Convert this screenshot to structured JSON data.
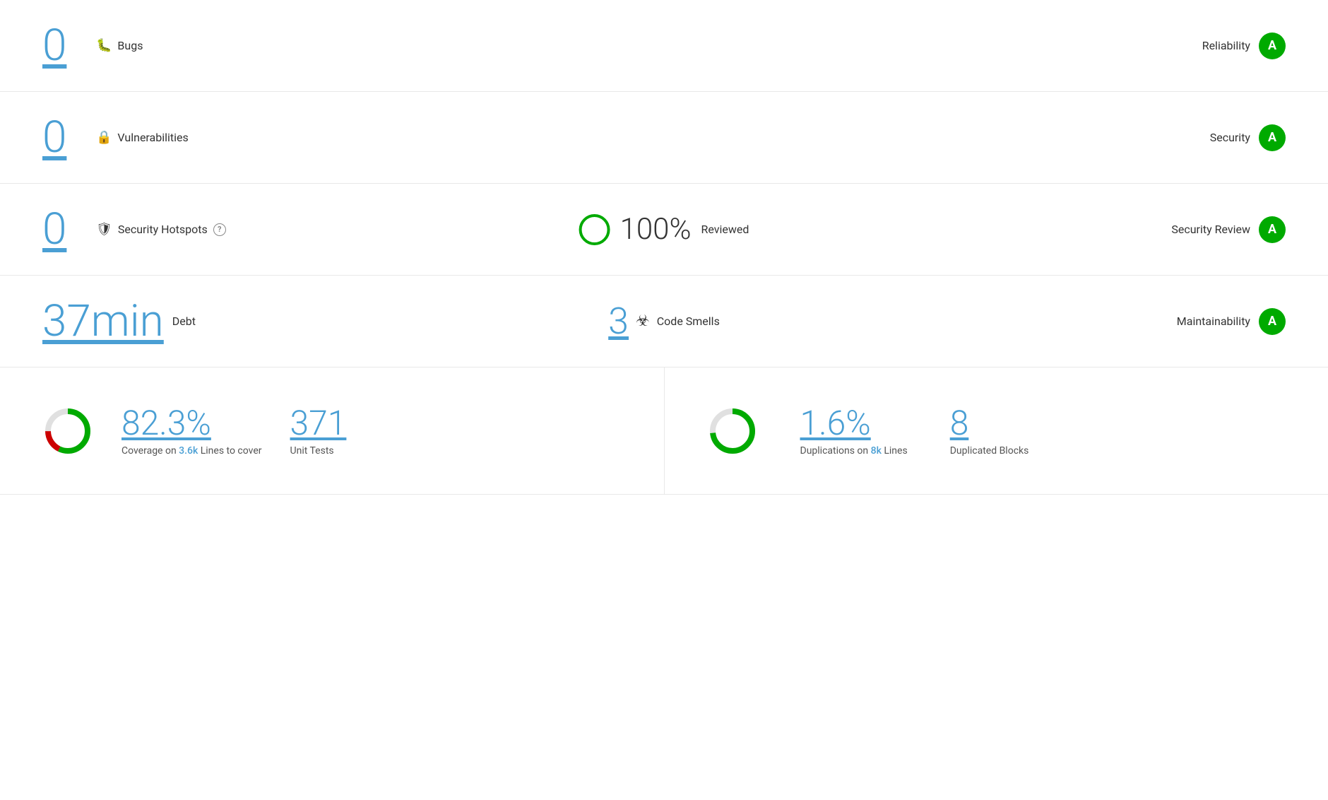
{
  "bugs": {
    "count": "0",
    "label": "Bugs",
    "section": "Reliability",
    "grade": "A"
  },
  "vulnerabilities": {
    "count": "0",
    "label": "Vulnerabilities",
    "section": "Security",
    "grade": "A"
  },
  "security_hotspots": {
    "count": "0",
    "label": "Security Hotspots",
    "help": "?",
    "reviewed_pct": "100%",
    "reviewed_label": "Reviewed",
    "section": "Security Review",
    "grade": "A"
  },
  "maintainability": {
    "debt": "37min",
    "debt_label": "Debt",
    "smells_count": "3",
    "smells_label": "Code Smells",
    "section": "Maintainability",
    "grade": "A"
  },
  "coverage": {
    "pct": "82.3%",
    "sub_text": "Coverage on ",
    "lines_count": "3.6k",
    "lines_label": " Lines to cover",
    "unit_count": "371",
    "unit_label": "Unit Tests"
  },
  "duplications": {
    "pct": "1.6%",
    "sub_text": "Duplications on ",
    "lines_count": "8k",
    "lines_label": " Lines",
    "blocks_count": "8",
    "blocks_label": "Duplicated Blocks"
  }
}
